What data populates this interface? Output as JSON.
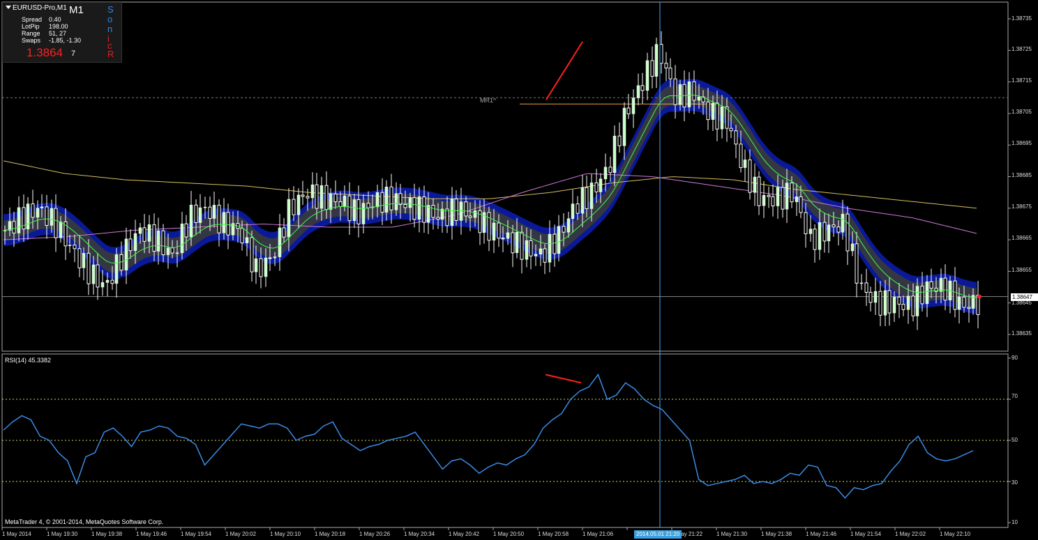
{
  "info_panel": {
    "symbol": "EURUSD-Pro,M1",
    "timeframe": "M1",
    "rows": [
      {
        "label": "Spread",
        "value": "0.40"
      },
      {
        "label": "LotPip",
        "value": "198.00"
      },
      {
        "label": "Range",
        "value": "51, 27"
      },
      {
        "label": "Swaps",
        "value": "-1.85, -1.30"
      }
    ],
    "price_main": "1.3864",
    "price_small": "7",
    "sonicr": [
      "S",
      "o",
      "n",
      "i",
      "c",
      "R"
    ]
  },
  "price_axis": [
    "1.38735",
    "1.38725",
    "1.38715",
    "1.38705",
    "1.38695",
    "1.38685",
    "1.38675",
    "1.38665",
    "1.38655",
    "1.38645",
    "1.38635"
  ],
  "current_price": "1.38647",
  "rsi_axis": [
    "90",
    "70",
    "50",
    "30",
    "10"
  ],
  "rsi_label": "RSI(14) 45.3382",
  "time_axis": [
    "1 May 2014",
    "1 May 19:30",
    "1 May 19:38",
    "1 May 19:46",
    "1 May 19:54",
    "1 May 20:02",
    "1 May 20:10",
    "1 May 20:18",
    "1 May 20:26",
    "1 May 20:34",
    "1 May 20:42",
    "1 May 20:50",
    "1 May 20:58",
    "1 May 21:06",
    "1 May 21:22",
    "1 May 21:30",
    "1 May 21:38",
    "1 May 21:46",
    "1 May 21:54",
    "1 May 22:02",
    "1 May 22:10"
  ],
  "cursor_time": "2014.05.01 21:20",
  "pivot_label": "MR1^",
  "copyright": "MetaTrader 4, © 2001-2014, MetaQuotes Software Corp.",
  "colors": {
    "bull_candle": "#c8ffc8",
    "band": "#0a1aa0",
    "band_inner": "#3a3a3a",
    "ema": "#40ff40",
    "yellow_ma": "#d8c060",
    "pink_ma": "#d07ad8",
    "rsi_line": "#3a8ce8",
    "level": "#d8d860",
    "crosshair": "#4aa8ff",
    "divergence": "#ff2020"
  },
  "chart_data": [
    {
      "type": "candlestick",
      "symbol": "EURUSD-Pro",
      "timeframe": "M1",
      "ylim": [
        1.3863,
        1.3874
      ],
      "y_ticks": [
        1.38635,
        1.38645,
        1.38655,
        1.38665,
        1.38675,
        1.38685,
        1.38695,
        1.38705,
        1.38715,
        1.38725,
        1.38735
      ],
      "x_ticks": [
        "1 May 2014",
        "1 May 19:30",
        "1 May 19:38",
        "1 May 19:46",
        "1 May 19:54",
        "1 May 20:02",
        "1 May 20:10",
        "1 May 20:18",
        "1 May 20:26",
        "1 May 20:34",
        "1 May 20:42",
        "1 May 20:50",
        "1 May 20:58",
        "1 May 21:06",
        "1 May 21:22",
        "1 May 21:30",
        "1 May 21:38",
        "1 May 21:46",
        "1 May 21:54",
        "1 May 22:02",
        "1 May 22:10"
      ],
      "close_path": [
        1.38668,
        1.38672,
        1.38675,
        1.3867,
        1.38662,
        1.38655,
        1.3865,
        1.3866,
        1.38668,
        1.38665,
        1.3866,
        1.38672,
        1.38675,
        1.3867,
        1.38668,
        1.38655,
        1.3866,
        1.38675,
        1.3868,
        1.38678,
        1.38677,
        1.38673,
        1.38677,
        1.38678,
        1.38676,
        1.38674,
        1.38672,
        1.38675,
        1.38672,
        1.38668,
        1.38665,
        1.38662,
        1.3866,
        1.38666,
        1.38676,
        1.3868,
        1.38688,
        1.38705,
        1.38715,
        1.38725,
        1.3871,
        1.38712,
        1.38705,
        1.38703,
        1.38688,
        1.38678,
        1.38678,
        1.3868,
        1.38665,
        1.38668,
        1.3867,
        1.3865,
        1.38645,
        1.38645,
        1.38644,
        1.3865,
        1.3865,
        1.38644,
        1.38645
      ],
      "current_price": 1.38647,
      "horizontal_lines": [
        1.38647,
        1.3871
      ],
      "pivot": {
        "label": "MR1^",
        "price": 1.3871
      },
      "moving_averages": [
        {
          "values": [
            1.3869,
            1.38686,
            1.38684,
            1.38683,
            1.38682,
            1.3868,
            1.38679,
            1.38678,
            1.38678,
            1.3868,
            1.38683,
            1.38685,
            1.38684,
            1.38681,
            1.38679,
            1.38677,
            1.38675
          ]
        },
        {
          "values": [
            1.38665,
            1.38666,
            1.38668,
            1.38669,
            1.3867,
            1.38669,
            1.38669,
            1.38673,
            1.3868,
            1.38686,
            1.38685,
            1.38682,
            1.38679,
            1.38675,
            1.38672,
            1.38667
          ]
        }
      ]
    },
    {
      "type": "line",
      "title": "RSI(14) 45.3382",
      "ylim": [
        10,
        90
      ],
      "y_ticks": [
        10,
        30,
        50,
        70,
        90
      ],
      "levels": [
        30,
        50,
        70
      ],
      "series": [
        {
          "values": [
            55,
            59,
            62,
            60,
            52,
            50,
            44,
            40,
            29,
            42,
            44,
            54,
            56,
            52,
            47,
            54,
            55,
            57,
            56,
            52,
            51,
            48,
            38,
            43,
            48,
            53,
            58,
            57,
            56,
            58,
            58,
            56,
            50,
            52,
            53,
            57,
            59,
            51,
            48,
            45,
            47,
            48,
            50,
            51,
            52,
            54,
            48,
            42,
            36,
            40,
            41,
            38,
            34,
            37,
            39,
            38,
            41,
            43,
            48,
            56,
            60,
            63,
            70,
            74,
            76,
            82,
            70,
            72,
            78,
            75,
            70,
            67,
            65,
            60,
            55,
            50,
            31,
            28,
            29,
            30,
            31,
            33,
            29,
            30,
            29,
            31,
            34,
            33,
            38,
            37,
            28,
            27,
            22,
            27,
            26,
            28,
            29,
            35,
            40,
            48,
            52,
            44,
            41,
            40,
            41,
            43,
            45
          ]
        }
      ],
      "current_value": 45.3382
    }
  ]
}
